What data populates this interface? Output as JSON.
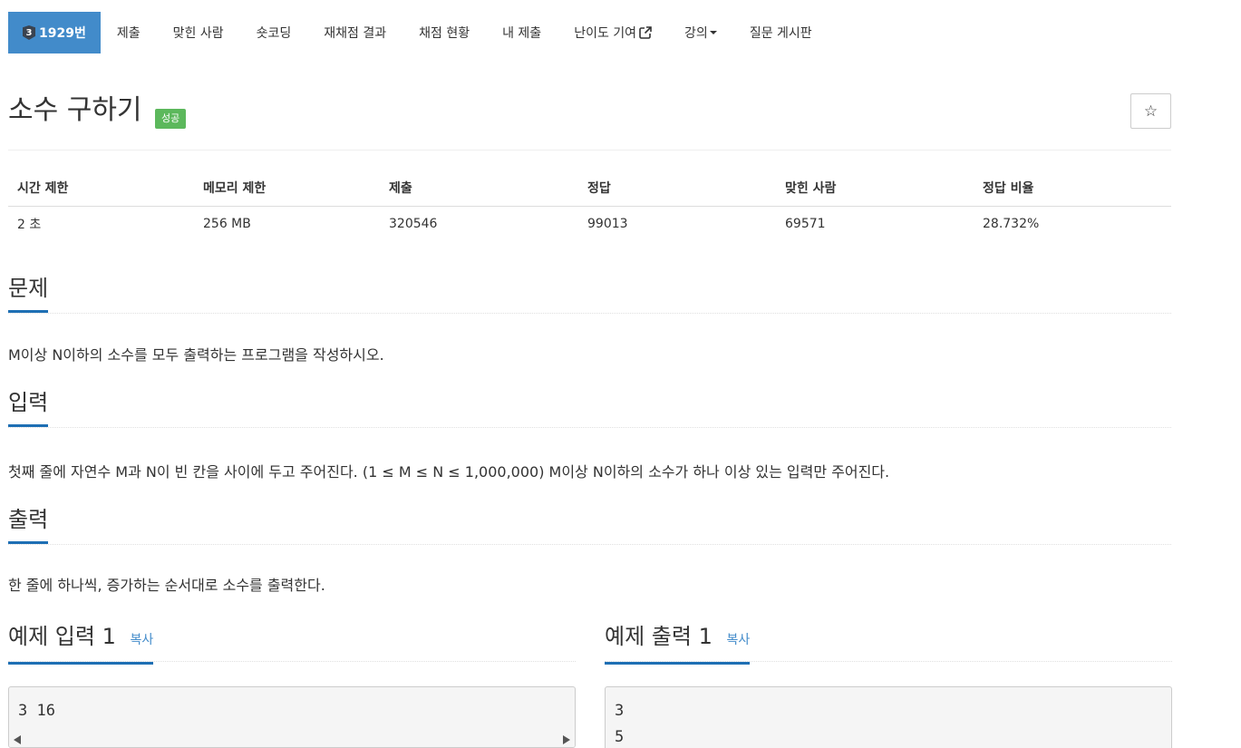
{
  "nav": {
    "tier_badge": "3",
    "problem_number": "1929번",
    "items": [
      "제출",
      "맞힌 사람",
      "숏코딩",
      "재채점 결과",
      "채점 현황",
      "내 제출",
      "난이도 기여",
      "강의",
      "질문 게시판"
    ]
  },
  "problem": {
    "title": "소수 구하기",
    "status_badge": "성공",
    "star_symbol": "☆"
  },
  "info_table": {
    "headers": [
      "시간 제한",
      "메모리 제한",
      "제출",
      "정답",
      "맞힌 사람",
      "정답 비율"
    ],
    "values": [
      "2 초",
      "256 MB",
      "320546",
      "99013",
      "69571",
      "28.732%"
    ]
  },
  "sections": {
    "problem_heading": "문제",
    "problem_text": "M이상 N이하의 소수를 모두 출력하는 프로그램을 작성하시오.",
    "input_heading": "입력",
    "input_text": "첫째 줄에 자연수 M과 N이 빈 칸을 사이에 두고 주어진다. (1 ≤ M ≤ N ≤ 1,000,000) M이상 N이하의 소수가 하나 이상 있는 입력만 주어진다.",
    "output_heading": "출력",
    "output_text": "한 줄에 하나씩, 증가하는 순서대로 소수를 출력한다."
  },
  "examples": {
    "input_heading": "예제 입력 1",
    "output_heading": "예제 출력 1",
    "copy_label": "복사",
    "input_lines": [
      "3 16"
    ],
    "output_lines": [
      "3",
      "5"
    ]
  },
  "colors": {
    "nav_active": "#428bca",
    "success": "#5cb85c",
    "heading_underline": "#1e6fb4",
    "link": "#428bca"
  }
}
